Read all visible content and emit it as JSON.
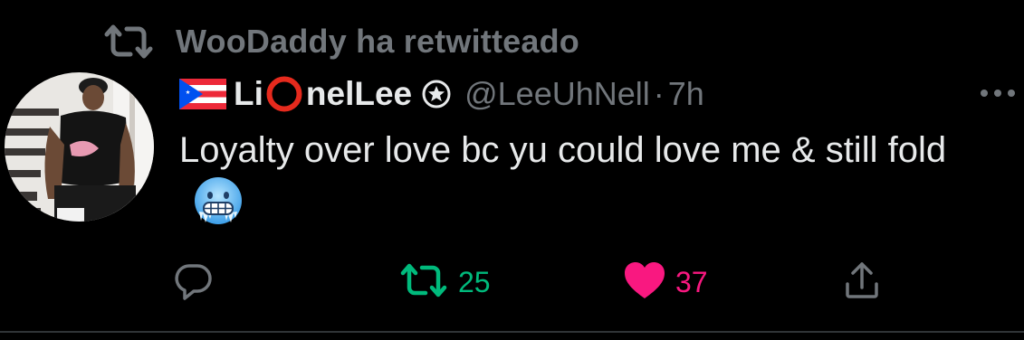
{
  "retweet_banner": {
    "text": "WooDaddy ha retwitteado",
    "icon": "retweet-icon"
  },
  "author": {
    "display_name_prefix": "Li",
    "display_name_suffix": "nelLee",
    "handle": "@LeeUhNell",
    "separator": "·",
    "time": "7h",
    "flag": "puerto-rico-flag-icon",
    "verified_icon": "verified-badge-icon"
  },
  "tweet": {
    "text": "Loyalty over love bc yu could love me & still fold",
    "emoji": "cold-face-emoji"
  },
  "actions": {
    "reply_count": "",
    "retweet_count": "25",
    "like_count": "37"
  },
  "colors": {
    "background": "#000000",
    "text": "#e7e9ea",
    "muted": "#71767b",
    "retweet_green": "#00ba7c",
    "like_pink": "#f91880"
  }
}
